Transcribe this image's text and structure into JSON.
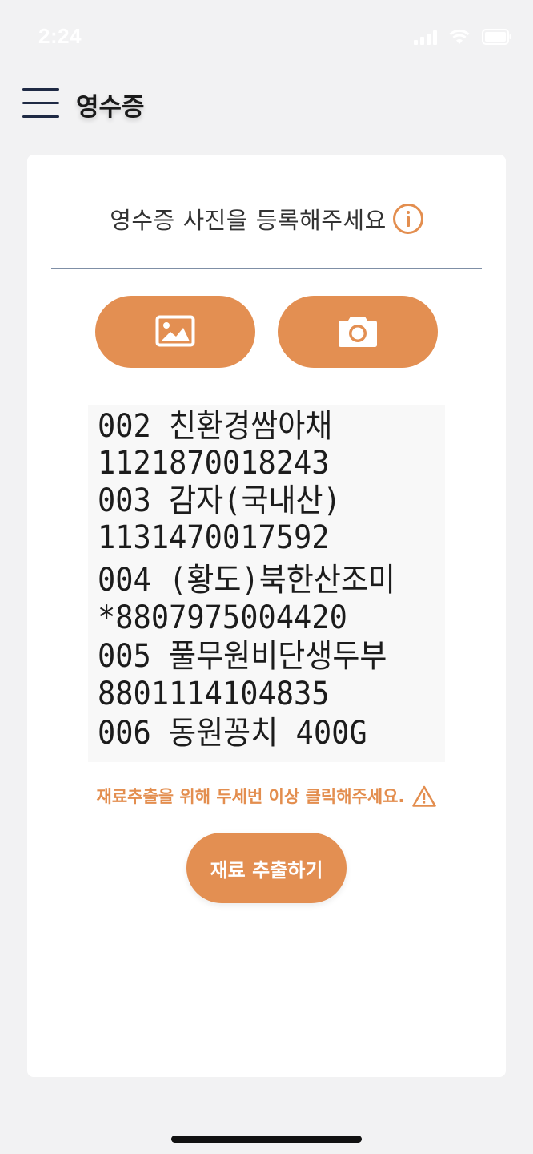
{
  "status_bar": {
    "time": "2:24",
    "icons": [
      "signal-icon",
      "wifi-icon",
      "battery-icon"
    ]
  },
  "header": {
    "menu_icon": "hamburger-menu-icon",
    "title": "영수증"
  },
  "card": {
    "heading": "영수증 사진을 등록해주세요",
    "info_icon": "info-icon",
    "gallery_button_icon": "image-icon",
    "camera_button_icon": "camera-icon",
    "receipt_lines": [
      "002 친환경쌈아채",
      " 1121870018243",
      "003 감자(국내산)",
      " 1131470017592",
      "004 (황도)북한산조미",
      "*8807975004420",
      "005 풀무원비단생두부",
      " 8801114104835",
      "006 동원꽁치 400G"
    ],
    "warning_text": "재료추출을 위해 두세번 이상 클릭해주세요.",
    "warning_icon": "warning-triangle-icon",
    "extract_button_label": "재료 추출하기"
  },
  "colors": {
    "accent": "#e38f52",
    "background": "#f2f2f3",
    "card": "#ffffff",
    "title_text": "#1a1a1a",
    "menu_icon": "#1f2a44"
  }
}
